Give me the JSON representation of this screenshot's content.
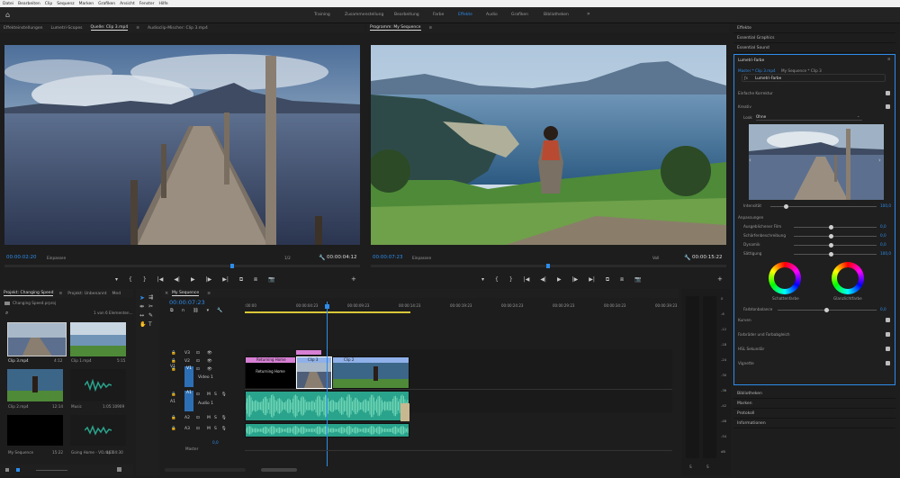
{
  "menu": [
    "Datei",
    "Bearbeiten",
    "Clip",
    "Sequenz",
    "Marken",
    "Grafiken",
    "Ansicht",
    "Fenster",
    "Hilfe"
  ],
  "workspaces": [
    "Training",
    "Zusammenstellung",
    "Bearbeitung",
    "Farbe",
    "Effekte",
    "Audio",
    "Grafiken",
    "Bibliotheken"
  ],
  "workspace_overflow": "»",
  "active_workspace": "Effekte",
  "source_tabs": [
    "Effekteinstellungen",
    "Lumetri-Scopes",
    "Quelle: Clip 3.mp4",
    "Audioclip-Mischer: Clip 3.mp4"
  ],
  "source_menu_glyph": "≡",
  "program_tab": "Programm: My Sequence",
  "program_menu_glyph": "≡",
  "source": {
    "tc_left": "00:00:02:20",
    "fit": "Einpassen",
    "ratio": "1/2",
    "tc_right": "00:00:04:12"
  },
  "program": {
    "tc_left": "00:00:07:23",
    "fit": "Einpassen",
    "quality": "Voll",
    "tc_right": "00:00:15:22"
  },
  "transport": [
    "+",
    "▾",
    "{",
    "}",
    "|◀",
    "◀|",
    "▶",
    "|▶",
    "▶|",
    "⧉",
    "⧈",
    "📷"
  ],
  "project": {
    "tab_active": "Projekt: Changing Speed",
    "tab_menu_glyph": "≡",
    "tab2": "Projekt: Unbenannt",
    "tab3": "Med",
    "file": "Changing Speed.prproj",
    "count": "1 von 6 Elementen...",
    "items": [
      {
        "name": "Clip 3.mp4",
        "dur": "4:12"
      },
      {
        "name": "Clip 1.mp4",
        "dur": "5:15"
      },
      {
        "name": "Clip 2.mp4",
        "dur": "12:14"
      },
      {
        "name": "Music",
        "dur": "1:05:10909"
      },
      {
        "name": "My Sequence",
        "dur": "15:22"
      },
      {
        "name": "Going Home - VO.mp3",
        "dur": "16:04:30"
      }
    ]
  },
  "timeline": {
    "tab": "My Sequence",
    "tab_menu_glyph": "≡",
    "tc": "00:00:07:23",
    "ruler": [
      ":00:00",
      "00:00:04:23",
      "00:00:09:23",
      "00:00:14:23",
      "00:00:19:23",
      "00:00:24:23",
      "00:00:29:23",
      "00:00:34:23",
      "00:00:39:23"
    ],
    "video_tracks": [
      "V3",
      "V2",
      "V1"
    ],
    "video1_name": "Video 1",
    "audio_tracks": [
      "A1",
      "A2",
      "A3"
    ],
    "audio1_name": "Audio 1",
    "master": "Master",
    "master_value": "0,0",
    "track_src": {
      "v1": "V1",
      "a1": "A1"
    },
    "clip_titles": [
      "Returning Home",
      "Clip 3",
      "Clip 2"
    ],
    "title_clip_text": "Returning Home",
    "track_buttons": {
      "lock": "🔒",
      "target": "⊡",
      "eye": "👁",
      "mute": "M",
      "solo": "S",
      "mic": "🎙"
    }
  },
  "meter": {
    "labels": [
      "0",
      "-6",
      "-12",
      "-18",
      "-24",
      "-30",
      "-36",
      "-42",
      "-48",
      "-54",
      "dB"
    ],
    "solo": [
      "S",
      "S"
    ]
  },
  "right_panels_top": [
    "Effekte",
    "Essential Graphics",
    "Essential Sound"
  ],
  "lumetri": {
    "title": "Lumetri-Farbe",
    "title_menu_glyph": "≡",
    "master": "Master * Clip 3.mp4",
    "seq": "My Sequence * Clip 3",
    "effect": "Lumetri-Farbe",
    "basic": "Einfache Korrektur",
    "creative": "Kreativ",
    "look_label": "Look",
    "look_value": "Ohne",
    "intensity_label": "Intensität",
    "intensity_value": "100,0",
    "adjust": "Anpassungen",
    "sliders": [
      {
        "label": "Ausgeblichener Film",
        "value": "0,0",
        "pos": 0.45
      },
      {
        "label": "Schärfenbeschreibung",
        "value": "0,0",
        "pos": 0.45
      },
      {
        "label": "Dynamik",
        "value": "0,0",
        "pos": 0.45
      },
      {
        "label": "Sättigung",
        "value": "100,0",
        "pos": 0.45
      }
    ],
    "shadow": "Schattenfarbe",
    "highlight": "Glanzlichtfarbe",
    "balance_label": "Farbtonbalance",
    "balance_value": "0,0",
    "sections": [
      "Kurven",
      "Farbräder und Farbabgleich",
      "HSL Sekundär",
      "Vignette"
    ]
  },
  "right_panels_bottom": [
    "Bibliotheken",
    "Marken",
    "Protokoll",
    "Informationen"
  ],
  "colors": {
    "accent": "#2d8ceb",
    "video_clip": "#6a8fd0",
    "audio_clip": "#2aa38c",
    "title_clip": "#d67fd3",
    "work_bar": "#d9c838"
  }
}
